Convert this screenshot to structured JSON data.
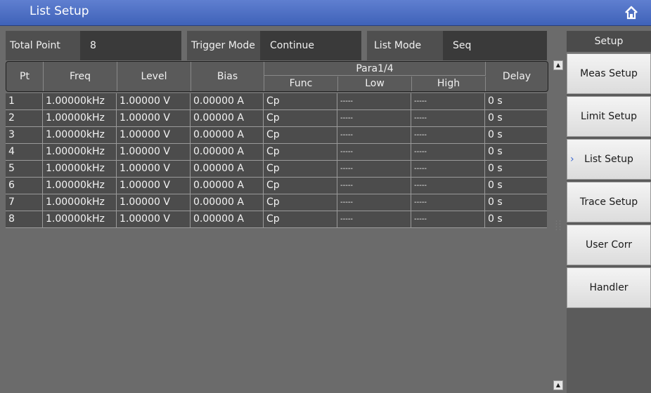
{
  "window": {
    "title": "List Setup",
    "home_icon": "home-icon"
  },
  "info": {
    "total_point_label": "Total Point",
    "total_point_value": "8",
    "trigger_mode_label": "Trigger Mode",
    "trigger_mode_value": "Continue",
    "list_mode_label": "List Mode",
    "list_mode_value": "Seq"
  },
  "table": {
    "headers": {
      "pt": "Pt",
      "freq": "Freq",
      "level": "Level",
      "bias": "Bias",
      "para": "Para1/4",
      "func": "Func",
      "low": "Low",
      "high": "High",
      "delay": "Delay"
    },
    "rows": [
      {
        "pt": "1",
        "freq": "1.00000kHz",
        "level": "1.00000 V",
        "bias": "0.00000 A",
        "func": "Cp",
        "low": "-----",
        "high": "-----",
        "delay": "0 s"
      },
      {
        "pt": "2",
        "freq": "1.00000kHz",
        "level": "1.00000 V",
        "bias": "0.00000 A",
        "func": "Cp",
        "low": "-----",
        "high": "-----",
        "delay": "0 s"
      },
      {
        "pt": "3",
        "freq": "1.00000kHz",
        "level": "1.00000 V",
        "bias": "0.00000 A",
        "func": "Cp",
        "low": "-----",
        "high": "-----",
        "delay": "0 s"
      },
      {
        "pt": "4",
        "freq": "1.00000kHz",
        "level": "1.00000 V",
        "bias": "0.00000 A",
        "func": "Cp",
        "low": "-----",
        "high": "-----",
        "delay": "0 s"
      },
      {
        "pt": "5",
        "freq": "1.00000kHz",
        "level": "1.00000 V",
        "bias": "0.00000 A",
        "func": "Cp",
        "low": "-----",
        "high": "-----",
        "delay": "0 s"
      },
      {
        "pt": "6",
        "freq": "1.00000kHz",
        "level": "1.00000 V",
        "bias": "0.00000 A",
        "func": "Cp",
        "low": "-----",
        "high": "-----",
        "delay": "0 s"
      },
      {
        "pt": "7",
        "freq": "1.00000kHz",
        "level": "1.00000 V",
        "bias": "0.00000 A",
        "func": "Cp",
        "low": "-----",
        "high": "-----",
        "delay": "0 s"
      },
      {
        "pt": "8",
        "freq": "1.00000kHz",
        "level": "1.00000 V",
        "bias": "0.00000 A",
        "func": "Cp",
        "low": "-----",
        "high": "-----",
        "delay": "0 s"
      }
    ]
  },
  "sidepanel": {
    "header": "Setup",
    "buttons": [
      "Meas Setup",
      "Limit Setup",
      "List Setup",
      "Trace Setup",
      "User Corr",
      "Handler"
    ],
    "active_index": 2
  },
  "colors": {
    "titlebar": "#4a6cc4",
    "accent": "#3a66d0"
  }
}
